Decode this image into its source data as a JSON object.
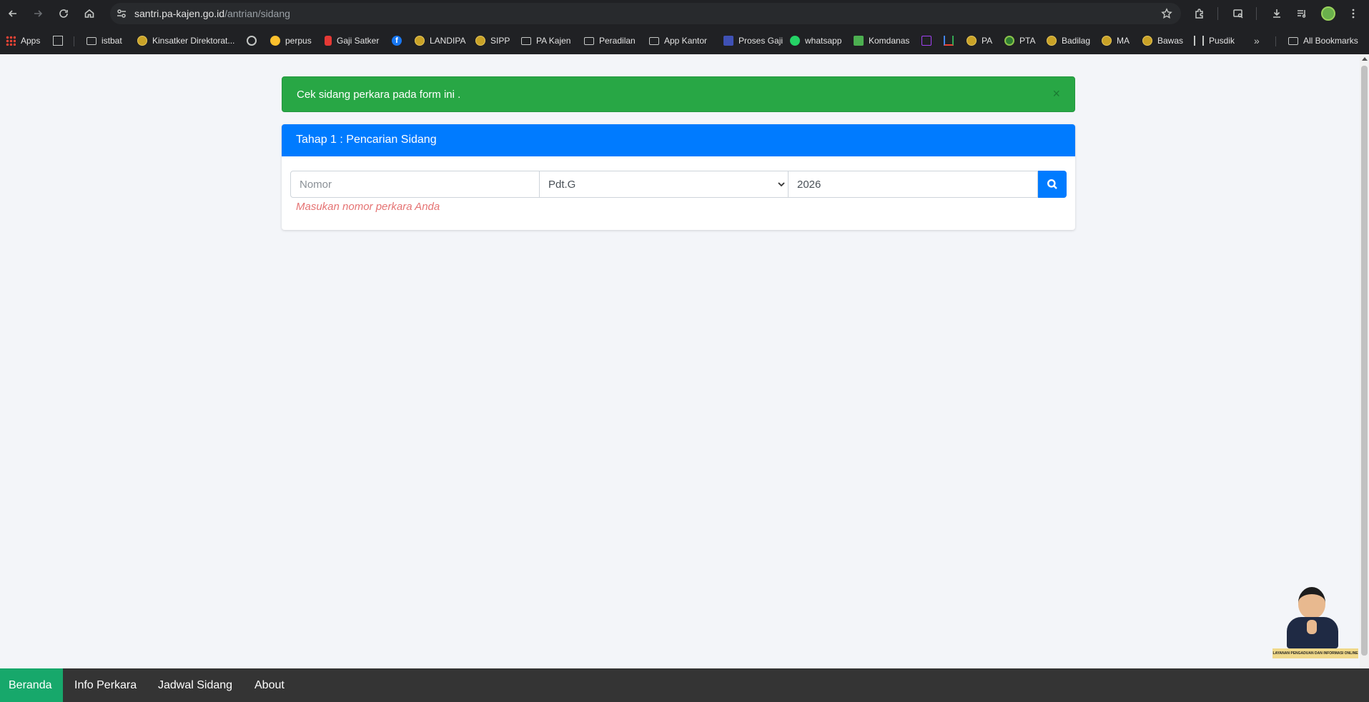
{
  "browser": {
    "url_host": "santri.pa-kajen.go.id",
    "url_path": "/antrian/sidang",
    "bookmarks": [
      {
        "label": "Apps",
        "icon": "apps-grid-icon"
      },
      {
        "label": "",
        "icon": "tab-groups-icon"
      },
      {
        "label": "istbat",
        "icon": "folder-icon"
      },
      {
        "label": "Kinsatker Direktorat...",
        "icon": "coin-logo-icon"
      },
      {
        "label": "",
        "icon": "globe-icon"
      },
      {
        "label": "perpus",
        "icon": "perpus-logo-icon"
      },
      {
        "label": "Gaji Satker",
        "icon": "gaji-logo-icon"
      },
      {
        "label": "",
        "icon": "facebook-icon"
      },
      {
        "label": "LANDIPA",
        "icon": "coin-logo-icon"
      },
      {
        "label": "SIPP",
        "icon": "coin-logo-icon"
      },
      {
        "label": "PA Kajen",
        "icon": "folder-icon"
      },
      {
        "label": "Peradilan",
        "icon": "folder-icon"
      },
      {
        "label": "App Kantor",
        "icon": "folder-icon"
      },
      {
        "label": "Proses Gaji",
        "icon": "proses-gaji-logo-icon"
      },
      {
        "label": "whatsapp",
        "icon": "whatsapp-icon"
      },
      {
        "label": "Komdanas",
        "icon": "komdanas-logo-icon"
      },
      {
        "label": "",
        "icon": "mail-icon"
      },
      {
        "label": "",
        "icon": "gmail-icon"
      },
      {
        "label": "PA",
        "icon": "coin-logo-icon"
      },
      {
        "label": "PTA",
        "icon": "pta-logo-icon"
      },
      {
        "label": "Badilag",
        "icon": "coin-logo-icon"
      },
      {
        "label": "MA",
        "icon": "coin-logo-icon"
      },
      {
        "label": "Bawas",
        "icon": "coin-logo-icon"
      },
      {
        "label": "Pusdik",
        "icon": "pusdik-logo-icon"
      }
    ],
    "more_label": "»",
    "all_bookmarks_label": "All Bookmarks"
  },
  "alert": {
    "message": "Cek sidang perkara pada form ini .",
    "close_label": "×",
    "color": "#28a745"
  },
  "card": {
    "title": "Tahap 1 : Pencarian Sidang",
    "header_color": "#007bff",
    "nomor_placeholder": "Nomor",
    "jenis_selected": "Pdt.G",
    "tahun_value": "2026",
    "help_text": "Masukan nomor perkara Anda"
  },
  "mascot": {
    "label": "LAYANAN PENGADUAN DAN INFORMASI ONLINE"
  },
  "bottom_nav": {
    "items": [
      "Beranda",
      "Info Perkara",
      "Jadwal Sidang",
      "About"
    ],
    "active_index": 0,
    "active_color": "#17a86b"
  }
}
